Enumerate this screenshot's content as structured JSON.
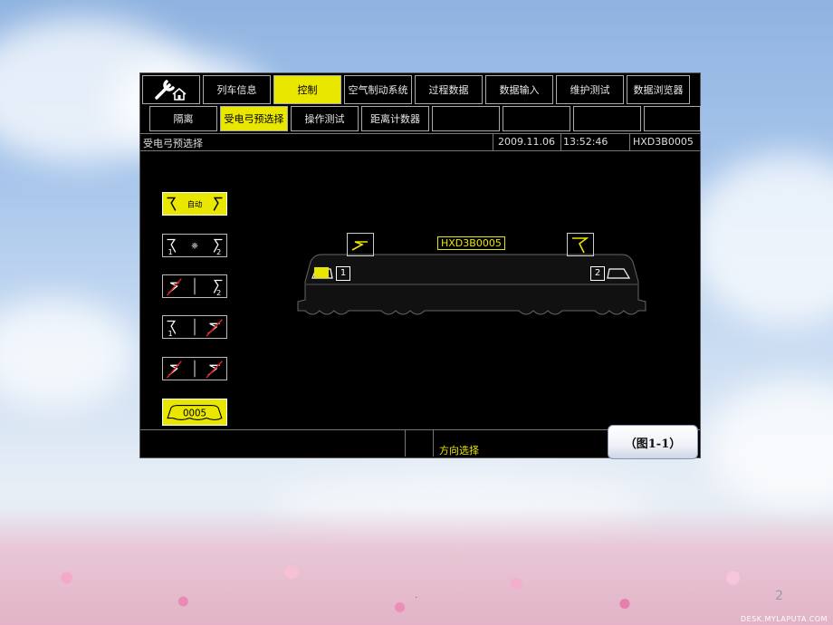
{
  "tabs_row1": [
    "列车信息",
    "控制",
    "空气制动系统",
    "过程数据",
    "数据输入",
    "维护测试",
    "数据浏览器"
  ],
  "tabs_row2": [
    "隔离",
    "受电弓预选择",
    "操作测试",
    "距离计数器",
    "",
    "",
    "",
    ""
  ],
  "info": {
    "page_title": "受电弓预选择",
    "date": "2009.11.06",
    "time": "13:52:46",
    "loco_id": "HXD3B0005"
  },
  "panto_buttons": {
    "auto_label": "自动",
    "num1": "1",
    "num2": "2",
    "loco_number": "0005"
  },
  "loco": {
    "label": "HXD3B0005",
    "cab1": "1",
    "cab2": "2"
  },
  "bottom": {
    "direction_label": "方向选择"
  },
  "figure_button": "（图1-1）",
  "slide_page": "2",
  "watermark": "DESK.MYLAPUTA.COM",
  "colors": {
    "accent": "#e9e600",
    "screen_bg": "#000000"
  }
}
